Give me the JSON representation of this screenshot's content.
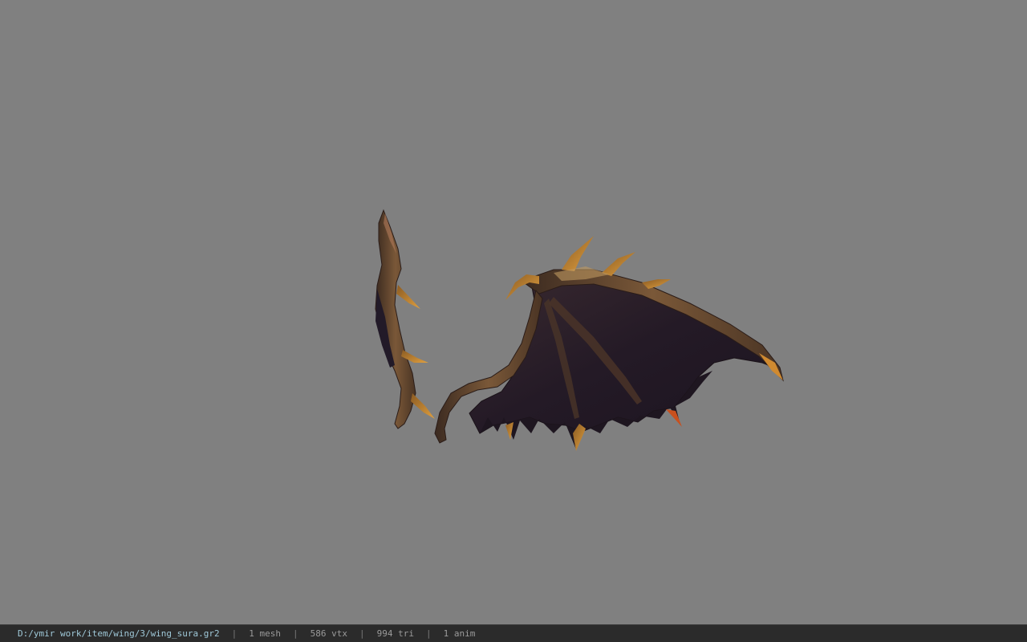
{
  "viewport": {
    "background_color": "#808080",
    "model_name": "wing_sura"
  },
  "statusbar": {
    "file_path": "D:/ymir work/item/wing/3/wing_sura.gr2",
    "mesh_count": "1 mesh",
    "vertex_count": "586 vtx",
    "triangle_count": "994 tri",
    "anim_count": "1 anim",
    "separator": "|",
    "path_color": "#9fc8d8",
    "text_color": "#9a9a9a"
  }
}
